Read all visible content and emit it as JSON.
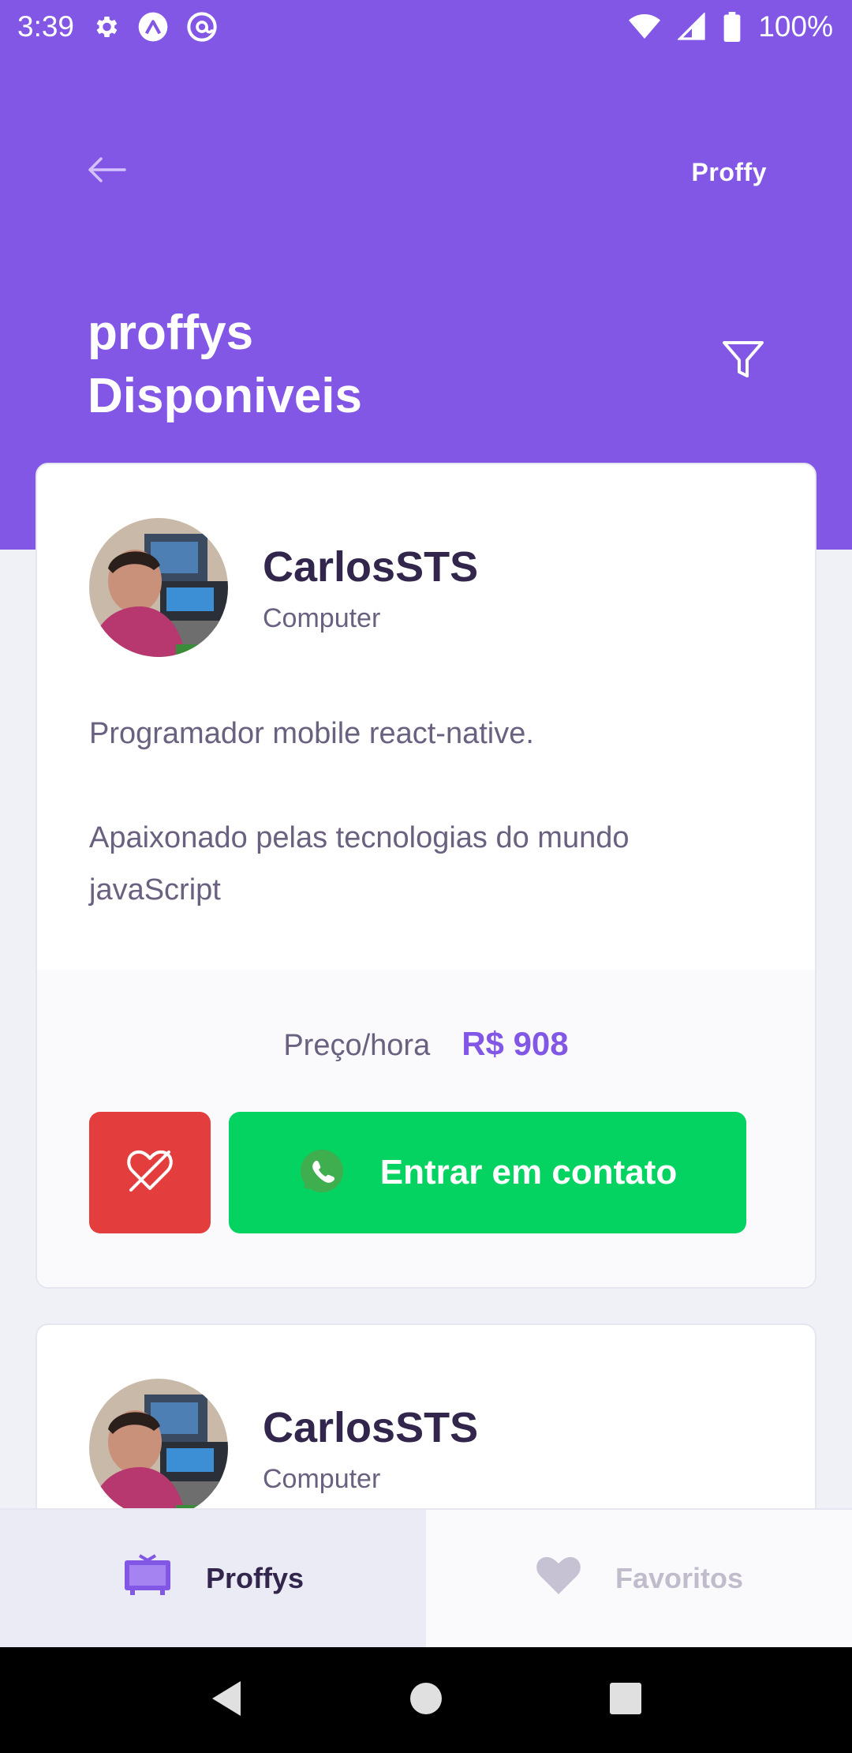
{
  "status_bar": {
    "time": "3:39",
    "battery": "100%",
    "icons": [
      "gear-icon",
      "expo-icon",
      "at-sign-icon",
      "wifi-icon",
      "signal-icon",
      "battery-icon"
    ]
  },
  "header": {
    "back_icon": "arrow-left-icon",
    "brand": "Proffy",
    "title_line1": "proffys",
    "title_line2": "Disponiveis",
    "filter_icon": "filter-icon"
  },
  "cards": [
    {
      "name": "CarlosSTS",
      "subject": "Computer",
      "bio_p1": "Programador mobile react-native.",
      "bio_p2": "Apaixonado pelas tecnologias do mundo javaScript",
      "price_label": "Preço/hora",
      "price_value": "R$ 908",
      "unfavorite_icon": "heart-off-icon",
      "contact_label": "Entrar em contato",
      "contact_icon": "whatsapp-icon"
    },
    {
      "name": "CarlosSTS",
      "subject": "Computer"
    }
  ],
  "tabs": [
    {
      "label": "Proffys",
      "icon": "tv-icon",
      "active": true
    },
    {
      "label": "Favoritos",
      "icon": "heart-icon",
      "active": false
    }
  ],
  "navigation": [
    "back-triangle-icon",
    "home-circle-icon",
    "recents-square-icon"
  ],
  "colors": {
    "primary": "#8257E5",
    "green": "#04D361",
    "red": "#E33D3D",
    "title_dark": "#32264D",
    "text": "#6A6180",
    "background": "#F0F0F7"
  }
}
